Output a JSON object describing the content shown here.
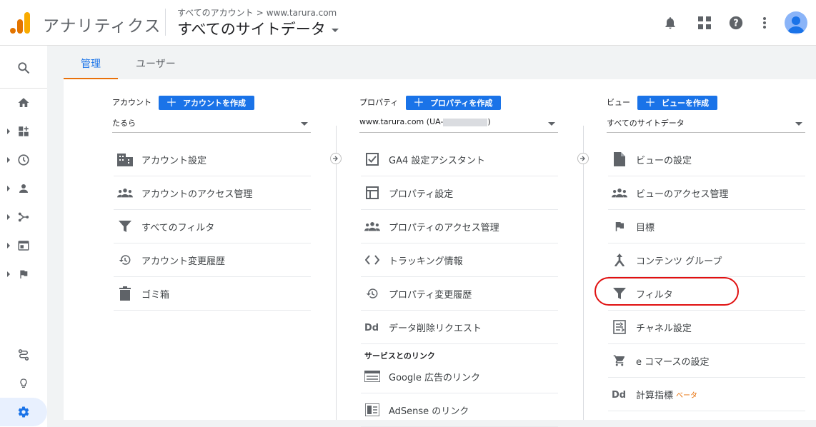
{
  "app": {
    "title": "アナリティクス"
  },
  "breadcrumb": {
    "all_accounts": "すべてのアカウント",
    "separator": ">",
    "account": "www.tarura.com"
  },
  "view_selector": {
    "label": "すべてのサイトデータ"
  },
  "tabs": [
    {
      "label": "管理",
      "active": true
    },
    {
      "label": "ユーザー",
      "active": false
    }
  ],
  "account_col": {
    "heading": "アカウント",
    "create_label": "アカウントを作成",
    "selected": "たるら",
    "items": [
      {
        "label": "アカウント設定",
        "icon": "building-icon"
      },
      {
        "label": "アカウントのアクセス管理",
        "icon": "people-icon"
      },
      {
        "label": "すべてのフィルタ",
        "icon": "filter-icon"
      },
      {
        "label": "アカウント変更履歴",
        "icon": "history-icon"
      },
      {
        "label": "ゴミ箱",
        "icon": "trash-icon"
      }
    ]
  },
  "property_col": {
    "heading": "プロパティ",
    "create_label": "プロパティを作成",
    "selected_prefix": "www.tarura.com (UA-",
    "selected_suffix": ")",
    "items": [
      {
        "label": "GA4 設定アシスタント",
        "icon": "checkbox-icon"
      },
      {
        "label": "プロパティ設定",
        "icon": "layout-icon"
      },
      {
        "label": "プロパティのアクセス管理",
        "icon": "people-icon"
      },
      {
        "label": "トラッキング情報",
        "icon": "code-icon"
      },
      {
        "label": "プロパティ変更履歴",
        "icon": "history-icon"
      },
      {
        "label": "データ削除リクエスト",
        "icon": "dd-icon"
      }
    ],
    "services_heading": "サービスとのリンク",
    "service_items": [
      {
        "label": "Google 広告のリンク",
        "icon": "ads-icon"
      },
      {
        "label": "AdSense のリンク",
        "icon": "adsense-icon"
      }
    ]
  },
  "view_col": {
    "heading": "ビュー",
    "create_label": "ビューを作成",
    "selected": "すべてのサイトデータ",
    "items": [
      {
        "label": "ビューの設定",
        "icon": "document-icon"
      },
      {
        "label": "ビューのアクセス管理",
        "icon": "people-icon"
      },
      {
        "label": "目標",
        "icon": "flag-icon"
      },
      {
        "label": "コンテンツ グループ",
        "icon": "merge-icon"
      },
      {
        "label": "フィルタ",
        "icon": "filter-icon"
      },
      {
        "label": "チャネル設定",
        "icon": "channel-icon"
      },
      {
        "label": "e コマースの設定",
        "icon": "cart-icon"
      },
      {
        "label": "計算指標",
        "icon": "dd-icon",
        "badge": "ベータ"
      }
    ]
  },
  "colors": {
    "accent": "#1a73e8",
    "tab_underline": "#e8710a",
    "highlight": "#e01010"
  }
}
